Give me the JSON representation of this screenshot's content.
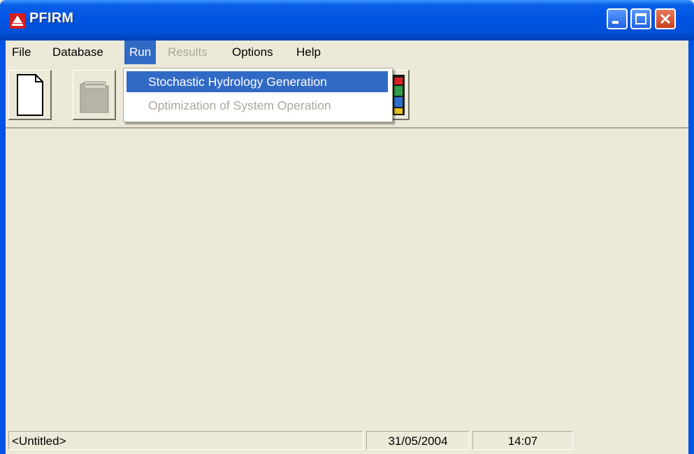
{
  "window": {
    "title": "PFIRM",
    "colors": {
      "titlebar": "#0054e3",
      "close_button": "#c63f1d",
      "menu_highlight": "#316ac5",
      "face": "#ece9d8",
      "disabled_text": "#aca899"
    },
    "controls": {
      "minimize_icon": "minimize-icon",
      "maximize_icon": "maximize-icon",
      "close_icon": "close-icon"
    }
  },
  "menubar": {
    "items": [
      {
        "label": "File",
        "state": "normal"
      },
      {
        "label": "Database",
        "state": "normal"
      },
      {
        "label": "Run",
        "state": "open"
      },
      {
        "label": "Results",
        "state": "disabled"
      },
      {
        "label": "Options",
        "state": "normal"
      },
      {
        "label": "Help",
        "state": "normal"
      }
    ]
  },
  "run_menu": {
    "items": [
      {
        "label": "Stochastic Hydrology Generation",
        "state": "highlighted"
      },
      {
        "label": "Optimization of System Operation",
        "state": "disabled"
      }
    ]
  },
  "toolbar": {
    "buttons": [
      {
        "icon": "new-document-icon"
      },
      {
        "icon": "open-folder-icon"
      },
      {
        "icon": "hidden-button"
      },
      {
        "icon": "hidden-button"
      },
      {
        "icon": "hidden-button"
      },
      {
        "icon": "hidden-button"
      },
      {
        "icon": "colored-bars-icon"
      }
    ]
  },
  "statusbar": {
    "filename": "<Untitled>",
    "date": "31/05/2004",
    "time": "14:07"
  }
}
